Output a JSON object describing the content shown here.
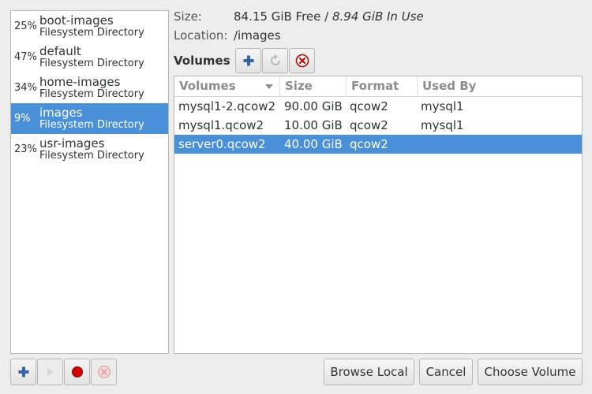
{
  "pools": [
    {
      "percent": "25%",
      "name": "boot-images",
      "type": "Filesystem Directory",
      "selected": false
    },
    {
      "percent": "47%",
      "name": "default",
      "type": "Filesystem Directory",
      "selected": false
    },
    {
      "percent": "34%",
      "name": "home-images",
      "type": "Filesystem Directory",
      "selected": false
    },
    {
      "percent": "9%",
      "name": "images",
      "type": "Filesystem Directory",
      "selected": true
    },
    {
      "percent": "23%",
      "name": "usr-images",
      "type": "Filesystem Directory",
      "selected": false
    }
  ],
  "info": {
    "size_label": "Size:",
    "free_text": "84.15 GiB Free",
    "separator": " / ",
    "inuse_text": "8.94 GiB In Use",
    "location_label": "Location:",
    "location_value": "/images"
  },
  "volumes": {
    "heading": "Volumes",
    "columns": [
      "Volumes",
      "Size",
      "Format",
      "Used By"
    ],
    "rows": [
      {
        "name": "mysql1-2.qcow2",
        "size": "90.00 GiB",
        "format": "qcow2",
        "used_by": "mysql1",
        "selected": false
      },
      {
        "name": "mysql1.qcow2",
        "size": "10.00 GiB",
        "format": "qcow2",
        "used_by": "mysql1",
        "selected": false
      },
      {
        "name": "server0.qcow2",
        "size": "40.00 GiB",
        "format": "qcow2",
        "used_by": "",
        "selected": true
      }
    ]
  },
  "buttons": {
    "browse_local": "Browse Local",
    "cancel": "Cancel",
    "choose_volume": "Choose Volume"
  },
  "icons": {
    "add": "add-icon",
    "start": "play-icon",
    "stop": "stop-icon",
    "delete": "delete-icon",
    "refresh": "refresh-icon"
  },
  "colors": {
    "selection": "#4a90d9",
    "add_icon": "#3465a4",
    "stop_icon": "#cc0000"
  }
}
